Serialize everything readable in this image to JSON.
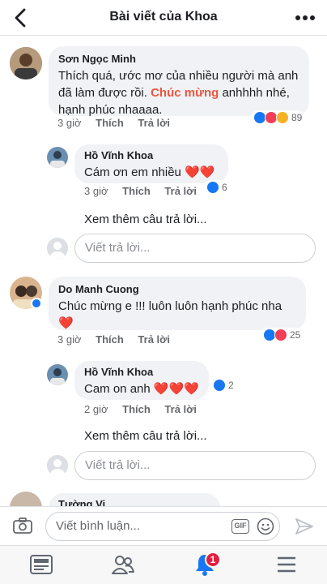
{
  "header": {
    "title": "Bài viết của Khoa"
  },
  "comments": [
    {
      "author": "Sơn Ngọc Minh",
      "text_before": "Thích quá, ước mơ của nhiều người mà anh đã làm được rồi. ",
      "text_highlight": "Chúc mừng",
      "text_after": " anhhhh nhé, hạnh phúc nhaaaa.",
      "time": "3 giờ",
      "like": "Thích",
      "reply": "Trả lời",
      "reaction_count": "89",
      "replies": [
        {
          "author": "Hồ Vĩnh Khoa",
          "text": "Cám ơn em nhiều",
          "hearts": "❤️❤️",
          "time": "3 giờ",
          "like": "Thích",
          "reply": "Trả lời",
          "reaction_count": "6"
        }
      ],
      "more_replies": "Xem thêm câu trả lời...",
      "reply_placeholder": "Viết trả lời..."
    },
    {
      "author": "Do Manh Cuong",
      "text": "Chúc mừng e  !!! luôn luôn  hạnh phúc nha",
      "hearts": "❤️",
      "time": "3 giờ",
      "like": "Thích",
      "reply": "Trả lời",
      "reaction_count": "25",
      "replies": [
        {
          "author": "Hồ Vĩnh Khoa",
          "text": "Cam on anh",
          "hearts": "❤️❤️❤️",
          "time": "2 giờ",
          "like": "Thích",
          "reply": "Trả lời",
          "reaction_count": "2"
        }
      ],
      "more_replies": "Xem thêm câu trả lời...",
      "reply_placeholder": "Viết trả lời..."
    },
    {
      "author": "Tường Vi"
    }
  ],
  "composer": {
    "placeholder": "Viết bình luận...",
    "gif_label": "GIF"
  },
  "tabbar": {
    "notification_count": "1"
  },
  "colors": {
    "accent": "#1877f2",
    "highlight": "#e9573f",
    "heart": "#e0245e",
    "badge": "#e41e3f"
  }
}
